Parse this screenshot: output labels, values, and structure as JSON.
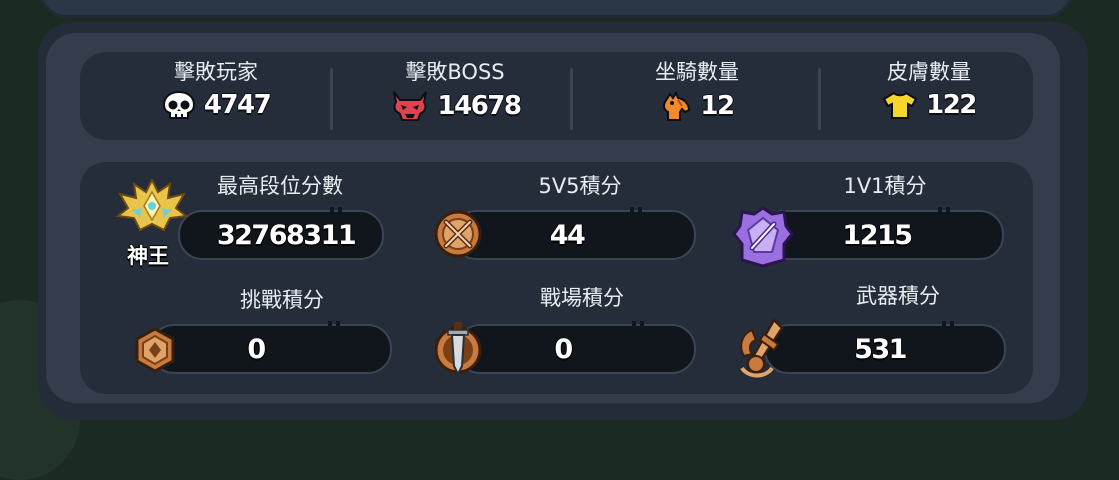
{
  "stats": [
    {
      "label": "擊敗玩家",
      "value": "4747",
      "icon": "skull-icon"
    },
    {
      "label": "擊敗BOSS",
      "value": "14678",
      "icon": "demon-skull-icon"
    },
    {
      "label": "坐騎數量",
      "value": "12",
      "icon": "horse-icon"
    },
    {
      "label": "皮膚數量",
      "value": "122",
      "icon": "shirt-icon"
    }
  ],
  "scores": {
    "rank": {
      "label": "最高段位分數",
      "value": "32768311",
      "rank_name": "神王"
    },
    "v5": {
      "label": "5V5積分",
      "value": "44"
    },
    "v1": {
      "label": "1V1積分",
      "value": "1215"
    },
    "challenge": {
      "label": "挑戰積分",
      "value": "0"
    },
    "battlefield": {
      "label": "戰場積分",
      "value": "0"
    },
    "weapon": {
      "label": "武器積分",
      "value": "531"
    }
  },
  "colors": {
    "panel": "#333d4b",
    "box": "#242d39",
    "bar": "#11161d",
    "skull": "#ffffff",
    "demon": "#e0434f",
    "horse": "#f28a2a",
    "shirt": "#f6d52c",
    "gold": "#e8c44a",
    "bronze": "#c87a3f",
    "purple": "#9b6fe0"
  }
}
